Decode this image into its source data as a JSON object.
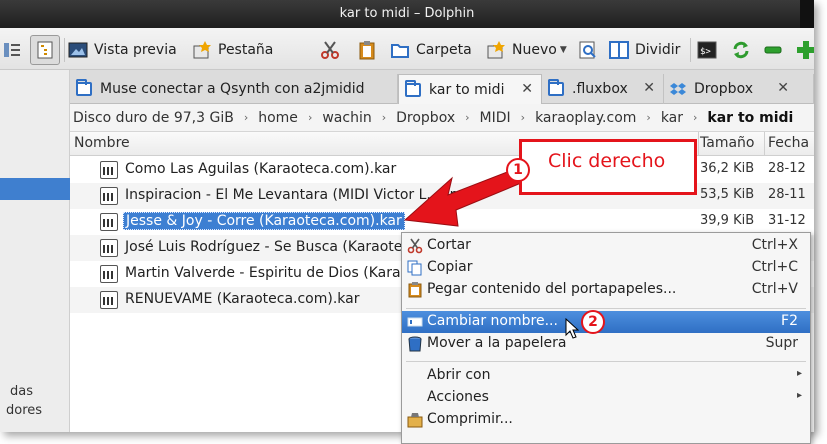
{
  "window": {
    "title": "kar to midi – Dolphin"
  },
  "toolbar": {
    "preview_label": "Vista previa",
    "tab_label": "Pestaña",
    "folder_label": "Carpeta",
    "new_label": "Nuevo",
    "split_label": "Dividir"
  },
  "places": {
    "text_1": "das",
    "text_2": "dores"
  },
  "tabs": [
    {
      "label": "Muse conectar a Qsynth con a2jmidid",
      "active": false
    },
    {
      "label": "kar to midi",
      "active": true
    },
    {
      "label": ".fluxbox",
      "active": false
    },
    {
      "label": "Dropbox",
      "active": false
    }
  ],
  "breadcrumb": [
    "Disco duro de 97,3 GiB",
    "home",
    "wachin",
    "Dropbox",
    "MIDI",
    "karaoplay.com",
    "kar",
    "kar to midi"
  ],
  "columns": {
    "name": "Nombre",
    "size": "Tamaño",
    "date": "Fecha"
  },
  "files": [
    {
      "name": "Como Las Aguilas (Karaoteca.com).kar",
      "size": "36,2 KiB",
      "date": "28-12"
    },
    {
      "name": "Inspiracion - El Me Levantara (MIDI Victor L... (midi",
      "size": "53,5 KiB",
      "date": "28-11"
    },
    {
      "name": "Jesse & Joy - Corre (Karaoteca.com).kar",
      "size": "39,9 KiB",
      "date": "31-12"
    },
    {
      "name": "José Luis Rodríguez - Se Busca (Karaote",
      "size": "",
      "date": ""
    },
    {
      "name": "Martin Valverde - Espiritu de Dios (Kara",
      "size": "",
      "date": ""
    },
    {
      "name": "RENUEVAME (Karaoteca.com).kar",
      "size": "",
      "date": ""
    }
  ],
  "context_menu": {
    "cut": {
      "label": "Cortar",
      "shortcut": "Ctrl+X"
    },
    "copy": {
      "label": "Copiar",
      "shortcut": "Ctrl+C"
    },
    "paste": {
      "label": "Pegar contenido del portapapeles...",
      "shortcut": "Ctrl+V"
    },
    "rename": {
      "label": "Cambiar nombre...",
      "shortcut": "F2"
    },
    "trash": {
      "label": "Mover a la papelera",
      "shortcut": "Supr"
    },
    "open_with": {
      "label": "Abrir con"
    },
    "actions": {
      "label": "Acciones"
    },
    "compress": {
      "label": "Comprimir..."
    }
  },
  "annotation": {
    "callout_text": "Clic derecho",
    "step_1": "1",
    "step_2": "2",
    "color": "#e4141b"
  },
  "colors": {
    "selection": "#3d7fd2",
    "titlebar": "#2a2a2a",
    "folder_icon": "#2f6fc4"
  }
}
